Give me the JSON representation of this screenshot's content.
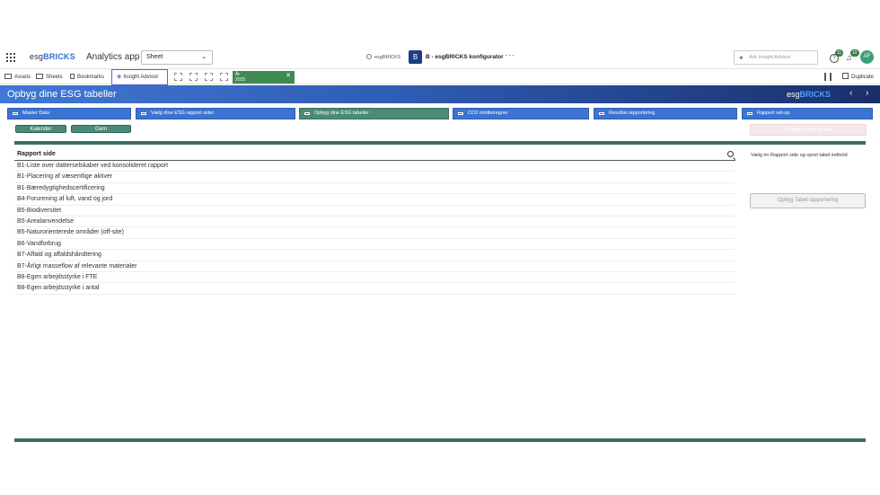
{
  "header": {
    "logo_prefix": "esg",
    "logo_brand": "BRICKS",
    "app_name": "Analytics app",
    "sheet_select": "Sheet",
    "user_label": "esgBRICKS",
    "brand_badge": "B",
    "app_title": "B - esgBRICKS konfigurator",
    "ask_placeholder": "Ask Insight Advisor",
    "help_badge": "11",
    "notifications_badge": "10",
    "avatar_initials": "AF"
  },
  "toolbar": {
    "assets": "Assets",
    "sheets": "Sheets",
    "bookmarks": "Bookmarks",
    "insight_advisor": "Insight Advisor",
    "selection_label": "År",
    "selection_value": "2025",
    "duplicate": "Duplicate"
  },
  "banner": {
    "title": "Opbyg dine ESG tabeller",
    "logo_prefix": "esg",
    "logo_brand": "BRICKS"
  },
  "nav": [
    "Master Data",
    "Vælg dine ESG rapport sider",
    "Opbyg dine ESG tabeller",
    "CO2 miniberegner",
    "Resultat rapportering",
    "Rapport set-up"
  ],
  "actions": {
    "kalender": "Kalender",
    "gem": "Gem",
    "ghost_button": "Rapport side opsæt"
  },
  "list": {
    "header": "Rapport side",
    "rows": [
      "B1-Liste over datterselskaber ved konsolideret rapport",
      "B1-Placering af væsentlige aktiver",
      "B1-Bæredygtighedscertificering",
      "B4-Forurening af luft, vand og jord",
      "B5-Biodiversitet",
      "B5-Arealanvendelse",
      "B5-Naturorienterede områder (off-site)",
      "B6-Vandforbrug",
      "B7-Affald og affaldshåndtering",
      "B7-Årligt masseflow af relevante materialer",
      "B8-Egen arbejdsstyrke i FTE",
      "B8-Egen arbejdsstyrke i antal"
    ]
  },
  "side": {
    "hint": "Vælg én Rapport side og opret tabel indhold",
    "disabled_button": "Opbyg Tabel rapportering"
  },
  "colors": {
    "accent_blue": "#3b74d2",
    "active_teal": "#4a8a78",
    "divider": "#3e6b63",
    "selection_green": "#3f8a52"
  }
}
